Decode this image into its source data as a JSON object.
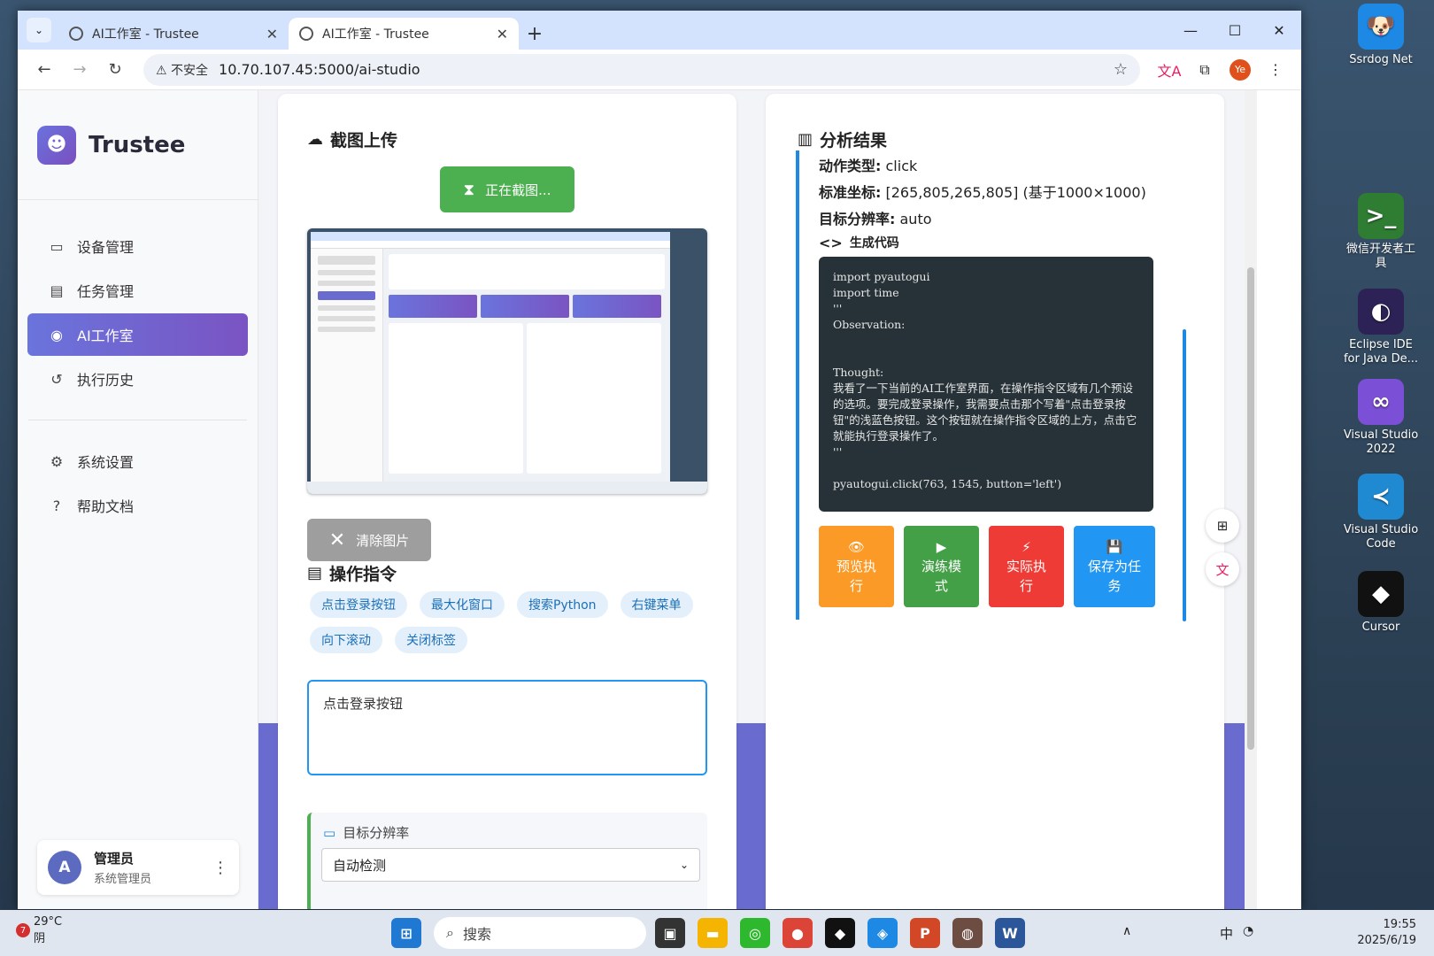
{
  "desktop": {
    "icons": [
      {
        "label": "Ssrdog Net",
        "color": "#1e88e5",
        "glyph": "🐶"
      },
      {
        "label": "微信开发者工具",
        "color": "#2e7d32",
        "glyph": ">_"
      },
      {
        "label": "Eclipse IDE for Java De...",
        "color": "#2c2255",
        "glyph": "◐"
      },
      {
        "label": "Visual Studio 2022",
        "color": "#7b4fd6",
        "glyph": "∞"
      },
      {
        "label": "Visual Studio Code",
        "color": "#1f8ad2",
        "glyph": "≺"
      },
      {
        "label": "Cursor",
        "color": "#111111",
        "glyph": "◆"
      }
    ]
  },
  "browser": {
    "tabs": [
      {
        "title": "AI工作室 - Trustee",
        "active": false
      },
      {
        "title": "AI工作室 - Trustee",
        "active": true
      }
    ],
    "insecure_label": "⚠ 不安全",
    "url": "10.70.107.45:5000/ai-studio",
    "profile_initials": "Ye"
  },
  "sidebar": {
    "brand": "Trustee",
    "items": [
      {
        "label": "设备管理",
        "icon": "devices-icon",
        "glyph": "▭"
      },
      {
        "label": "任务管理",
        "icon": "clipboard-icon",
        "glyph": "▤"
      },
      {
        "label": "AI工作室",
        "icon": "lightbulb-icon",
        "glyph": "◉",
        "active": true
      },
      {
        "label": "执行历史",
        "icon": "history-icon",
        "glyph": "↺"
      }
    ],
    "items2": [
      {
        "label": "系统设置",
        "icon": "gear-icon",
        "glyph": "⚙"
      },
      {
        "label": "帮助文档",
        "icon": "help-icon",
        "glyph": "?"
      }
    ],
    "user": {
      "initial": "A",
      "name": "管理员",
      "role": "系统管理员"
    }
  },
  "upload": {
    "title": "截图上传",
    "shot_button": "正在截图...",
    "clear_button": "清除图片",
    "commands_title": "操作指令",
    "chips": [
      "点击登录按钮",
      "最大化窗口",
      "搜索Python",
      "右键菜单",
      "向下滚动",
      "关闭标签"
    ],
    "command_value": "点击登录按钮",
    "resolution_label": "目标分辨率",
    "resolution_value": "自动检测"
  },
  "analysis": {
    "title": "分析结果",
    "action_type_label": "动作类型:",
    "action_type_value": "click",
    "coord_label": "标准坐标:",
    "coord_value": "[265,805,265,805] (基于1000×1000)",
    "res_label": "目标分辨率:",
    "res_value": "auto",
    "code_title": "生成代码",
    "code": "import pyautogui\nimport time\n'''\nObservation:\n\n\nThought:\n我看了一下当前的AI工作室界面，在操作指令区域有几个预设的选项。要完成登录操作，我需要点击那个写着\"点击登录按钮\"的浅蓝色按钮。这个按钮就在操作指令区域的上方，点击它就能执行登录操作了。\n'''\n\npyautogui.click(763, 1545, button='left')",
    "buttons": [
      {
        "label": "预览执行",
        "icon": "eye-icon",
        "glyph": "👁",
        "color": "#fb9a26"
      },
      {
        "label": "演练模式",
        "icon": "play-icon",
        "glyph": "▶",
        "color": "#43a047"
      },
      {
        "label": "实际执行",
        "icon": "bolt-icon",
        "glyph": "⚡",
        "color": "#ef3b36"
      },
      {
        "label": "保存为任务",
        "icon": "save-icon",
        "glyph": "💾",
        "color": "#2196f3"
      }
    ]
  },
  "taskbar": {
    "weather_badge": "7",
    "temp": "29°C",
    "condition": "阴",
    "search_placeholder": "搜索",
    "ime": "中",
    "time": "19:55",
    "date": "2025/6/19"
  }
}
